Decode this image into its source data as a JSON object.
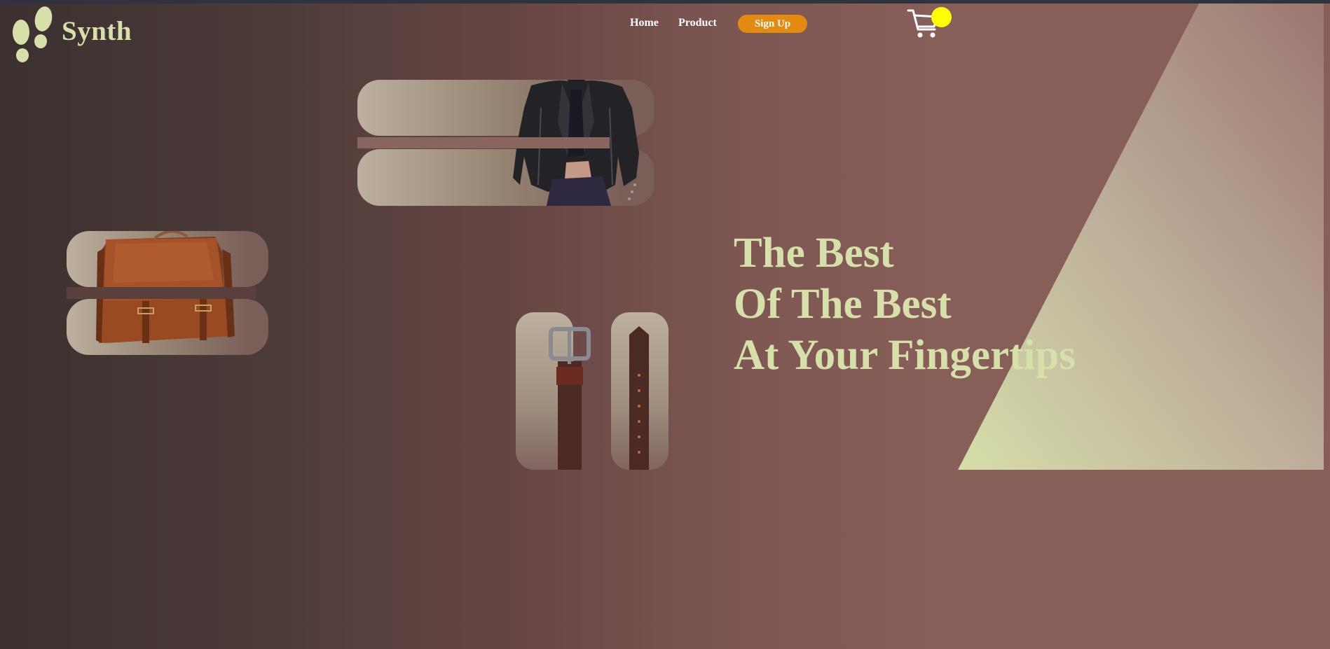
{
  "header": {
    "brand": "Synth",
    "logo_icon": "footprints-icon",
    "nav": [
      {
        "label": "Home"
      },
      {
        "label": "Product"
      }
    ],
    "signup_label": "Sign Up",
    "cart_icon": "shopping-cart-icon"
  },
  "products": [
    {
      "name": "leather-jacket",
      "icon": "leather-jacket-image"
    },
    {
      "name": "leather-bag",
      "icon": "leather-satchel-image"
    },
    {
      "name": "leather-belt",
      "icon": "leather-belt-image"
    }
  ],
  "hero": {
    "lines": [
      "The Best",
      "Of The Best",
      "At Your Fingertips"
    ]
  },
  "colors": {
    "accent_text": "#d7dfab",
    "signup_button": "#e38b0f",
    "cart_badge": "#ffff00",
    "background_dark": "#3b3030",
    "background_main": "#885e58"
  }
}
